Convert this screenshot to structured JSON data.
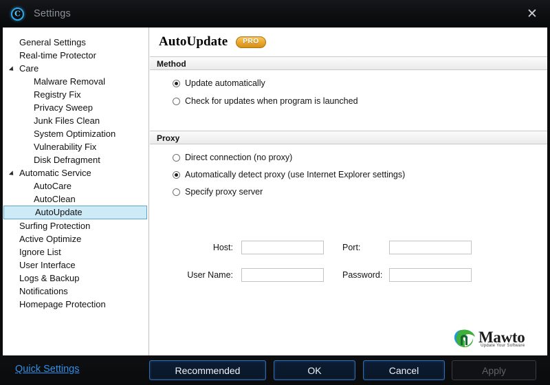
{
  "window": {
    "title": "Settings",
    "app_icon": "copyright-circle-icon",
    "close_label": "✕",
    "accent_blue": "#2ea8e8",
    "footer_link_blue": "#2f8fe8",
    "selection_blue": "#cdeaf7",
    "pro_badge_gold": "#eda92f"
  },
  "sidebar": {
    "items": [
      {
        "label": "General Settings",
        "level": 0,
        "type": "item",
        "selected": false
      },
      {
        "label": "Real-time Protector",
        "level": 0,
        "type": "item",
        "selected": false
      },
      {
        "label": "Care",
        "level": 0,
        "type": "group",
        "selected": false
      },
      {
        "label": "Malware Removal",
        "level": 1,
        "type": "item",
        "selected": false
      },
      {
        "label": "Registry Fix",
        "level": 1,
        "type": "item",
        "selected": false
      },
      {
        "label": "Privacy Sweep",
        "level": 1,
        "type": "item",
        "selected": false
      },
      {
        "label": "Junk Files Clean",
        "level": 1,
        "type": "item",
        "selected": false
      },
      {
        "label": "System Optimization",
        "level": 1,
        "type": "item",
        "selected": false
      },
      {
        "label": "Vulnerability Fix",
        "level": 1,
        "type": "item",
        "selected": false
      },
      {
        "label": "Disk Defragment",
        "level": 1,
        "type": "item",
        "selected": false
      },
      {
        "label": "Automatic Service",
        "level": 0,
        "type": "group",
        "selected": false
      },
      {
        "label": "AutoCare",
        "level": 1,
        "type": "item",
        "selected": false
      },
      {
        "label": "AutoClean",
        "level": 1,
        "type": "item",
        "selected": false
      },
      {
        "label": "AutoUpdate",
        "level": 1,
        "type": "item",
        "selected": true
      },
      {
        "label": "Surfing Protection",
        "level": 0,
        "type": "item",
        "selected": false
      },
      {
        "label": "Active Optimize",
        "level": 0,
        "type": "item",
        "selected": false
      },
      {
        "label": "Ignore List",
        "level": 0,
        "type": "item",
        "selected": false
      },
      {
        "label": "User Interface",
        "level": 0,
        "type": "item",
        "selected": false
      },
      {
        "label": "Logs & Backup",
        "level": 0,
        "type": "item",
        "selected": false
      },
      {
        "label": "Notifications",
        "level": 0,
        "type": "item",
        "selected": false
      },
      {
        "label": "Homepage Protection",
        "level": 0,
        "type": "item",
        "selected": false
      }
    ]
  },
  "page": {
    "title": "AutoUpdate",
    "badge": "PRO"
  },
  "method": {
    "header": "Method",
    "options": [
      {
        "label": "Update automatically",
        "checked": true
      },
      {
        "label": "Check for updates when program is launched",
        "checked": false
      }
    ]
  },
  "proxy": {
    "header": "Proxy",
    "options": [
      {
        "label": "Direct connection (no proxy)",
        "checked": false
      },
      {
        "label": "Automatically detect proxy (use Internet Explorer settings)",
        "checked": true
      },
      {
        "label": "Specify proxy server",
        "checked": false
      }
    ],
    "fields": [
      {
        "label": "Host:",
        "value": "",
        "placeholder": ""
      },
      {
        "label": "Port:",
        "value": "",
        "placeholder": ""
      },
      {
        "label": "User Name:",
        "value": "",
        "placeholder": ""
      },
      {
        "label": "Password:",
        "value": "",
        "placeholder": ""
      }
    ]
  },
  "watermark": {
    "name": "Mawto",
    "tagline": "Update Your Software"
  },
  "footer": {
    "quick_settings": "Quick Settings",
    "buttons": [
      {
        "label": "Recommended",
        "id": "btn-recommended",
        "disabled": false
      },
      {
        "label": "OK",
        "id": "btn-ok",
        "disabled": false
      },
      {
        "label": "Cancel",
        "id": "btn-cancel",
        "disabled": false
      },
      {
        "label": "Apply",
        "id": "btn-apply",
        "disabled": true
      }
    ]
  }
}
